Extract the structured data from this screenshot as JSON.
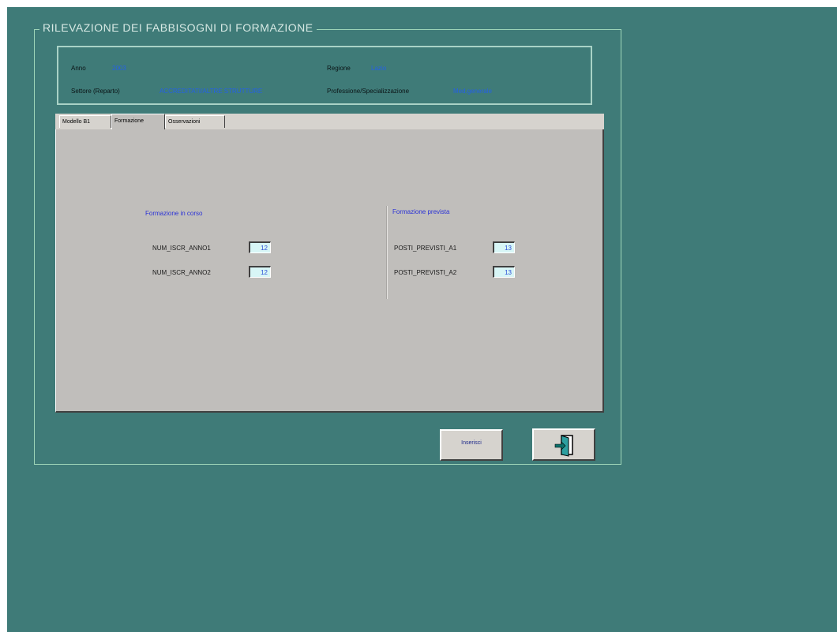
{
  "window": {
    "title": "RILEVAZIONE DEI FABBISOGNI DI FORMAZIONE"
  },
  "header": {
    "anno_label": "Anno",
    "anno_value": "2003",
    "regione_label": "Regione",
    "regione_value": "Lazio",
    "settore_label": "Settore (Reparto)",
    "settore_value": "ACCREDITATI/ALTRE STRUTTURE",
    "professione_label": "Professione/Specializzazione",
    "professione_value": "Med.generale"
  },
  "tabs": [
    {
      "label": "Modello B1"
    },
    {
      "label": "Formazione"
    },
    {
      "label": "Osservazioni"
    }
  ],
  "panel": {
    "left_section": {
      "title": "Formazione in corso",
      "fields": [
        {
          "label": "NUM_ISCR_ANNO1",
          "value": "12"
        },
        {
          "label": "NUM_ISCR_ANNO2",
          "value": "12"
        }
      ]
    },
    "right_section": {
      "title": "Formazione prevista",
      "fields": [
        {
          "label": "POSTI_PREVISTI_A1",
          "value": "13"
        },
        {
          "label": "POSTI_PREVISTI_A2",
          "value": "13"
        }
      ]
    }
  },
  "buttons": {
    "confirm_label": "Inserisci",
    "exit_icon": "exit-door-icon"
  },
  "colors": {
    "background": "#3f7b78",
    "panel": "#c0bebb",
    "value_text": "#2460e8"
  }
}
